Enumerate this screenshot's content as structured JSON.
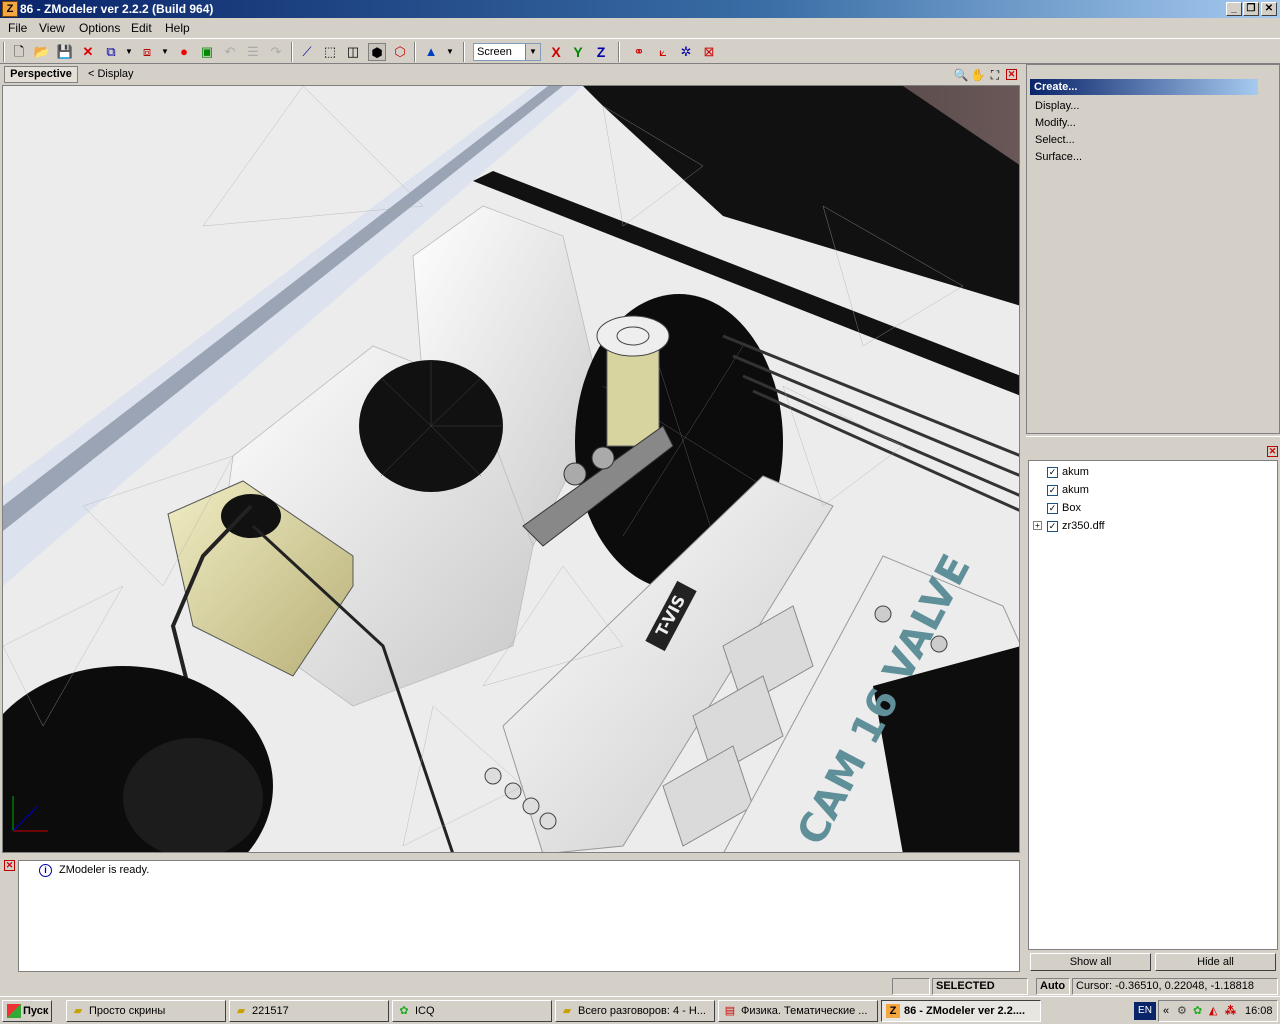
{
  "window": {
    "icon": "Z",
    "title": "86 - ZModeler ver 2.2.2 (Build 964)",
    "min": "_",
    "restore": "❐",
    "close": "✕"
  },
  "menu": [
    "File",
    "View",
    "Options",
    "Edit",
    "Help"
  ],
  "toolbar": {
    "view_select": "Screen",
    "axis_x": "X",
    "axis_y": "Y",
    "axis_z": "Z"
  },
  "viewport": {
    "tab": "Perspective",
    "display": "< Display",
    "labels": {
      "badge": "T-VIS",
      "engine": "CAM 16 VALVE"
    }
  },
  "right_panel": {
    "create": "Create...",
    "items": [
      "Display...",
      "Modify...",
      "Select...",
      "Surface..."
    ]
  },
  "tree": {
    "items": [
      {
        "label": "akum",
        "checked": true,
        "expandable": false
      },
      {
        "label": "akum",
        "checked": true,
        "expandable": false
      },
      {
        "label": "Box",
        "checked": true,
        "expandable": false
      },
      {
        "label": "zr350.dff",
        "checked": true,
        "expandable": true
      }
    ],
    "show_all": "Show all",
    "hide_all": "Hide all"
  },
  "log": {
    "message": "ZModeler is ready."
  },
  "status": {
    "mode": "SELECTED MODE",
    "auto": "Auto",
    "cursor": "Cursor: -0.36510, 0.22048, -1.18818"
  },
  "taskbar": {
    "start": "Пуск",
    "tasks": [
      {
        "label": "Просто скрины",
        "icon": "folder"
      },
      {
        "label": "221517",
        "icon": "folder"
      },
      {
        "label": "ICQ",
        "icon": "icq"
      },
      {
        "label": "Всего разговоров: 4 - Н...",
        "icon": "folder"
      },
      {
        "label": "Физика. Тематические ...",
        "icon": "pdf"
      },
      {
        "label": "86 - ZModeler ver 2.2....",
        "icon": "zmodeler"
      }
    ],
    "lang": "EN",
    "tray_expand": "«",
    "time": "16:08"
  },
  "colors": {
    "title_start": "#0a246a",
    "title_end": "#a6caf0",
    "tank": "#e8e4b0",
    "engine_text": "#5f8f98"
  }
}
